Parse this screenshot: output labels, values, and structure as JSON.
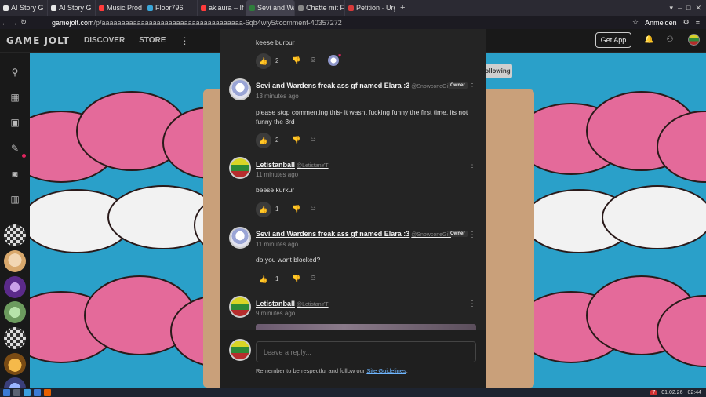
{
  "browser": {
    "tabs": [
      {
        "label": "AI Story G",
        "color": "#e6e6e6"
      },
      {
        "label": "AI Story G",
        "color": "#e6e6e6"
      },
      {
        "label": "Music Prod",
        "color": "#ff3b3b"
      },
      {
        "label": "Floor796",
        "color": "#3aa6d8"
      },
      {
        "label": "akiaura – If Y",
        "color": "#ff3b3b"
      },
      {
        "label": "Sevi and Wa",
        "color": "#2f7d3c"
      },
      {
        "label": "Chatte mit Fa",
        "color": "#888888"
      },
      {
        "label": "Petition · Urg",
        "color": "#d83a3a"
      }
    ],
    "active_tab_index": 5,
    "new_tab": "+",
    "url_domain": "gamejolt.com",
    "url_rest": "/p/aaaaaaaaaaaaaaaaaaaaaaaaaaaaaaaaaaaa-6qb4wiy5#comment-40357272",
    "login_label": "Anmelden"
  },
  "header": {
    "logo": "GAME JOLT",
    "nav": [
      "DISCOVER",
      "STORE"
    ],
    "get_app": "Get App"
  },
  "page": {
    "following_label": "Following"
  },
  "comments": [
    {
      "text": "keese burbur",
      "likes": "2",
      "liked": true,
      "has_reactor": true
    },
    {
      "name": "Sevi and Wardens freak ass gf named Elara :3",
      "handle": "@SnowconeGirl",
      "time": "13 minutes ago",
      "owner": "Owner",
      "text": "please stop commenting this- it wasnt fucking funny the first time, its not funny the 3rd",
      "likes": "2",
      "liked": true,
      "avatar": "anime"
    },
    {
      "name": "Letistanball",
      "handle": "@LetistanYT",
      "time": "11 minutes ago",
      "text": "beese kurkur",
      "likes": "1",
      "liked": true,
      "avatar": "flag"
    },
    {
      "name": "Sevi and Wardens freak ass gf named Elara :3",
      "handle": "@SnowconeGirl",
      "time": "11 minutes ago",
      "owner": "Owner",
      "text": "do you want blocked?",
      "likes": "1",
      "liked": false,
      "avatar": "anime"
    },
    {
      "name": "Letistanball",
      "handle": "@LetistanYT",
      "time": "9 minutes ago",
      "avatar": "flag"
    }
  ],
  "reply": {
    "placeholder": "Leave a reply...",
    "note_prefix": "Remember to be respectful and follow our ",
    "note_link": "Site Guidelines",
    "note_suffix": "."
  },
  "taskbar": {
    "date": "01.02.26",
    "time": "02:44",
    "badge": "7"
  }
}
